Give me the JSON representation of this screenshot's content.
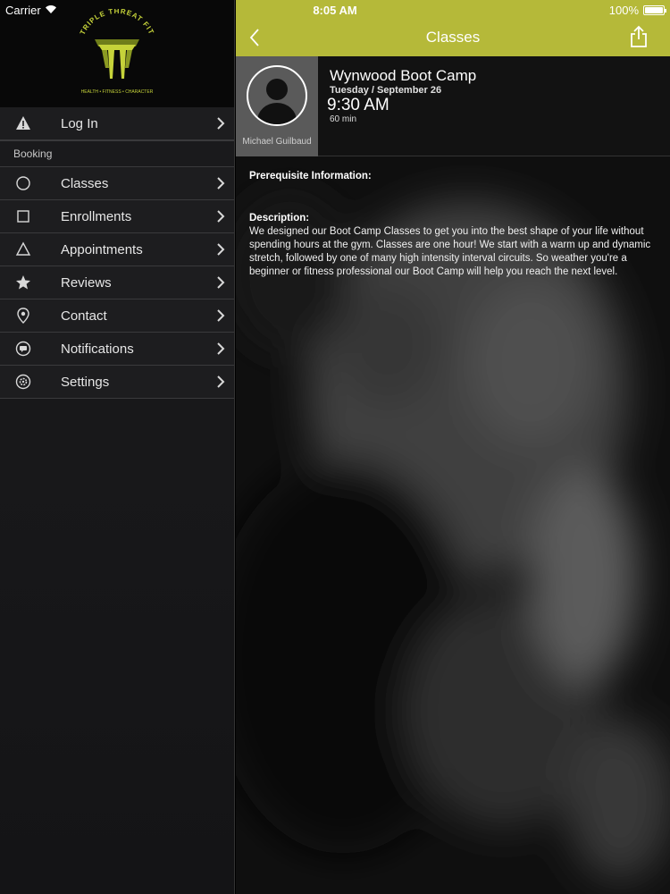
{
  "status_bar": {
    "carrier": "Carrier",
    "time": "8:05 AM",
    "battery": "100%"
  },
  "sidebar": {
    "logo_text": "TRIPLE THREAT FIT",
    "logo_tagline": "HEALTH • FITNESS • CHARACTER",
    "items_top": [
      {
        "label": "Log In",
        "icon": "warning-icon"
      }
    ],
    "section_label": "Booking",
    "items": [
      {
        "label": "Classes",
        "icon": "circle-icon"
      },
      {
        "label": "Enrollments",
        "icon": "square-icon"
      },
      {
        "label": "Appointments",
        "icon": "triangle-icon"
      },
      {
        "label": "Reviews",
        "icon": "star-icon"
      },
      {
        "label": "Contact",
        "icon": "location-pin-icon"
      },
      {
        "label": "Notifications",
        "icon": "message-icon"
      },
      {
        "label": "Settings",
        "icon": "gear-icon"
      }
    ]
  },
  "navbar": {
    "title": "Classes",
    "back_icon": "chevron-left-icon",
    "share_icon": "share-icon"
  },
  "class": {
    "instructor": "Michael Guilbaud",
    "name": "Wynwood Boot Camp",
    "date": "Tuesday / September 26",
    "time": "9:30 AM",
    "duration": "60 min"
  },
  "details": {
    "prereq_heading": "Prerequisite Information:",
    "description_heading": "Description:",
    "description": "We designed our Boot Camp Classes to get you into the best shape of your life without spending hours at the gym. Classes are one hour! We start with a warm up and dynamic stretch, followed by one of many high intensity interval circuits. So weather you're a beginner or fitness professional our Boot Camp will help you reach the next level."
  },
  "colors": {
    "accent": "#b5b939",
    "sidebar_bg": "#1d1d1f"
  }
}
